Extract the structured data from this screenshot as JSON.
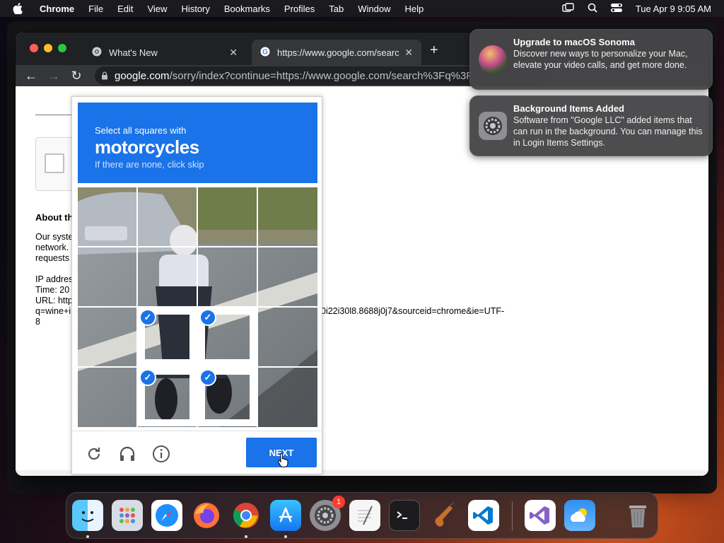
{
  "menubar": {
    "app_name": "Chrome",
    "items": [
      "File",
      "Edit",
      "View",
      "History",
      "Bookmarks",
      "Profiles",
      "Tab",
      "Window",
      "Help"
    ],
    "clock": "Tue Apr 9  9:05 AM"
  },
  "browser": {
    "tabs": [
      {
        "title": "What's New"
      },
      {
        "title": "https://www.google.com/search"
      }
    ],
    "address": {
      "domain": "google.com",
      "path": "/sorry/index?continue=https://www.google.com/search%3Fq%3F"
    }
  },
  "page": {
    "about_heading": "About th",
    "lines_a": [
      "Our syste",
      "network.",
      "requests"
    ],
    "lines_b": [
      "IP addres",
      "Time: 20",
      "URL: http",
      "q=wine+i",
      "8"
    ],
    "url_tail": "0i22i30l8.8688j0j7&sourceid=chrome&ie=UTF-"
  },
  "captcha": {
    "line1": "Select all squares with",
    "line2": "motorcycles",
    "line3": "If there are none, click skip",
    "next_label": "NEXT",
    "selected_tiles": [
      9,
      10,
      13,
      14
    ]
  },
  "notifications": [
    {
      "title": "Upgrade to macOS Sonoma",
      "body": "Discover new ways to personalize your Mac, elevate your video calls, and get more done."
    },
    {
      "title": "Background Items Added",
      "body": "Software from \"Google LLC\" added items that can run in the background. You can manage this in Login Items Settings."
    }
  ],
  "dock": {
    "apps": [
      "finder-icon",
      "launchpad-icon",
      "safari-icon",
      "firefox-icon",
      "chrome-icon",
      "app-store-icon",
      "system-settings-icon",
      "textedit-icon",
      "terminal-icon",
      "garageband-icon",
      "vscode-icon",
      "visual-studio-icon",
      "weather-icon",
      "trash-icon"
    ],
    "system_settings_badge": "1"
  },
  "colors": {
    "captcha_blue": "#1a73e8",
    "chrome_dark": "#202124",
    "menubar": "#1b1b1f"
  }
}
